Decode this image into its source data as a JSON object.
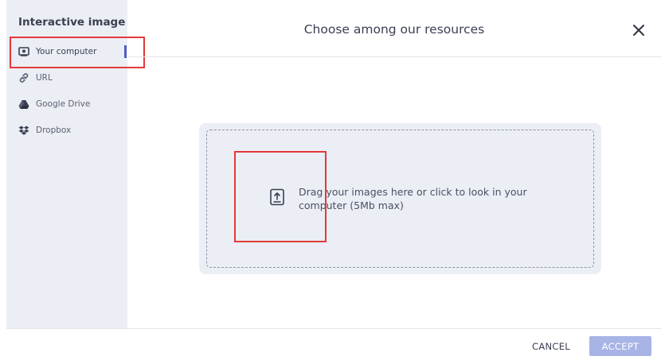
{
  "sidebar": {
    "title": "Interactive image",
    "items": [
      {
        "label": "Your computer",
        "icon": "computer-icon",
        "active": true
      },
      {
        "label": "URL",
        "icon": "link-icon"
      },
      {
        "label": "Google Drive",
        "icon": "google-drive-icon"
      },
      {
        "label": "Dropbox",
        "icon": "dropbox-icon"
      }
    ]
  },
  "header": {
    "title": "Choose among our resources",
    "close_icon": "close-icon"
  },
  "dropzone": {
    "icon": "upload-icon",
    "text": "Drag your images here or click to look in your computer (5Mb max)"
  },
  "footer": {
    "cancel_label": "CANCEL",
    "accept_label": "ACCEPT"
  },
  "colors": {
    "sidebar_bg": "#eceef5",
    "active_indicator": "#4d5fc1",
    "accept_bg": "#a8b4e6",
    "highlight": "#e23a3a"
  }
}
